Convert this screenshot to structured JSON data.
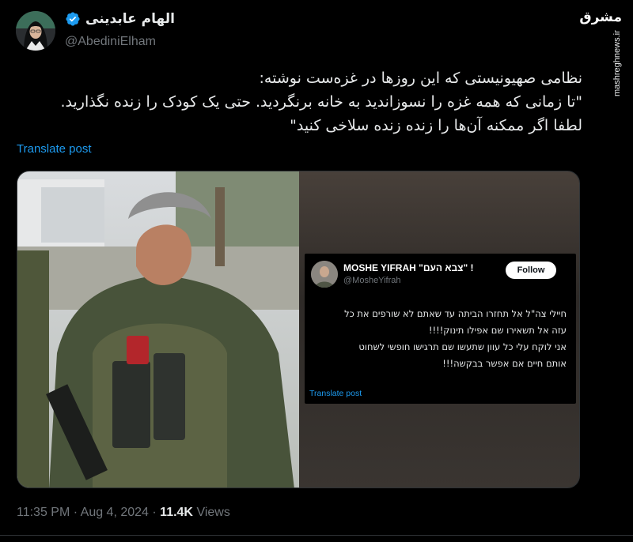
{
  "author": {
    "display_name": "الهام عابدینی",
    "handle": "@AbediniElham",
    "verified": true,
    "avatar_icon": "avatar-woman-hijab"
  },
  "watermark": {
    "logo_text": "مشرق",
    "url": "mashreghnews.ir"
  },
  "tweet": {
    "lines": [
      "نظامی صهیونیستی که این روزها در غزه‌ست نوشته:",
      "\"تا زمانی که همه غزه را نسوزاندید به خانه برنگردید. حتی یک کودک را زنده نگذارید.",
      "لطفا اگر ممکنه آن‌ها را زنده زنده سلاخی کنید\""
    ],
    "translate_label": "Translate post"
  },
  "embedded_post": {
    "name": "MOSHE YIFRAH \"צבא העם\" !",
    "handle": "@MosheYifrah",
    "follow_label": "Follow",
    "lines": [
      "חיילי צה\"ל אל תחזרו הביתה עד שאתם לא שורפים את כל",
      "עזה אל תשאירו שם אפילו תינוק!!!!",
      "אני לוקח עלי כל עוון שתעשו שם תרגישו חופשי לשחוט",
      "אותם חיים אם אפשר בבקשה!!!"
    ],
    "translate_label": "Translate post"
  },
  "meta": {
    "time": "11:35 PM",
    "separator": "·",
    "date": "Aug 4, 2024",
    "views_count": "11.4K",
    "views_label": "Views"
  },
  "colors": {
    "background": "#000000",
    "text": "#e7e9ea",
    "muted": "#71767b",
    "link": "#1d9bf0",
    "verified": "#1d9bf0"
  }
}
